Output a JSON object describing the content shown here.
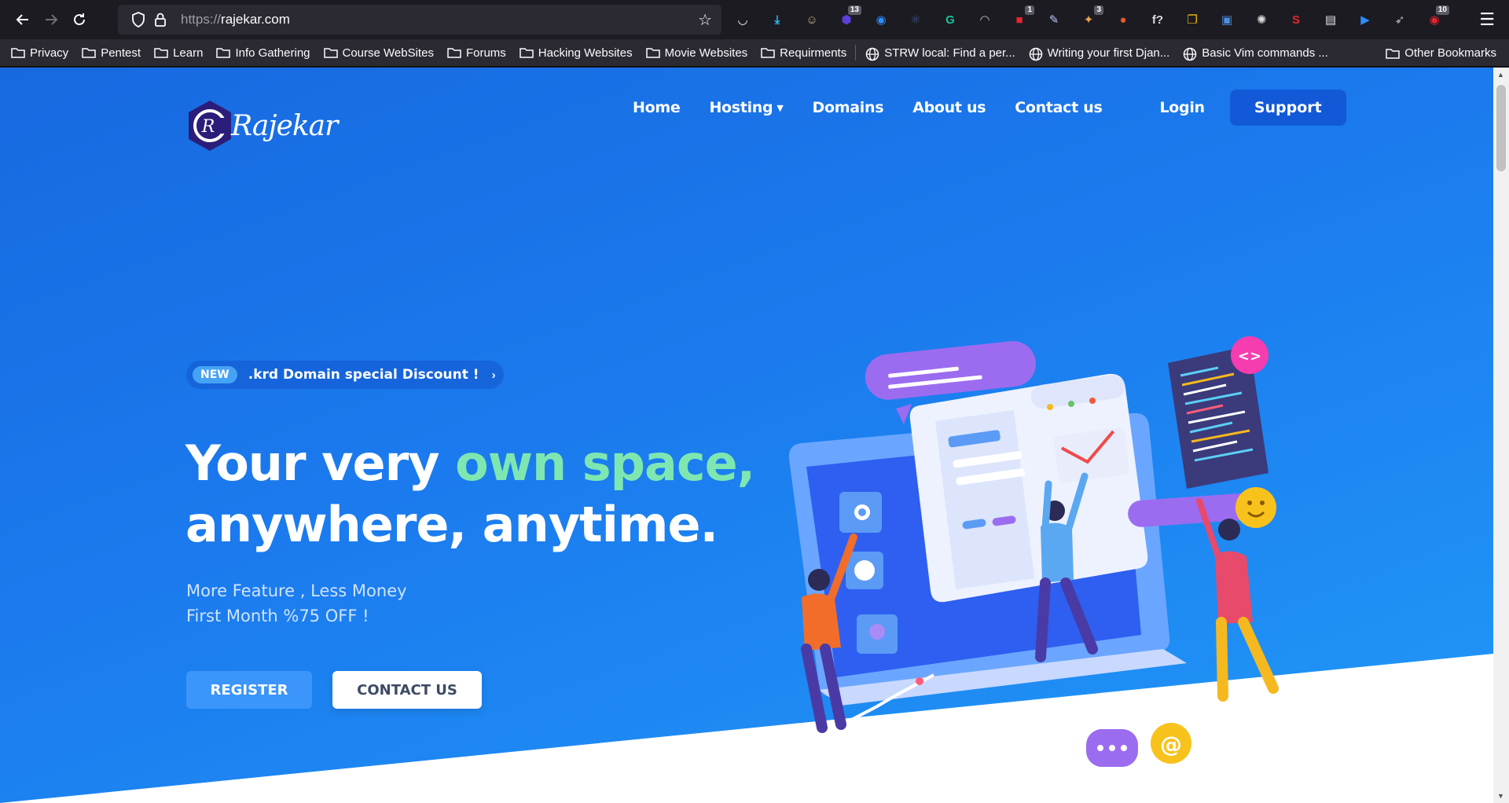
{
  "browser": {
    "url_scheme": "https://",
    "url_host": "rajekar.com",
    "extensions": [
      {
        "name": "pocket-icon",
        "color": "#fbfbfe",
        "glyph": "◡",
        "badge": ""
      },
      {
        "name": "download-icon",
        "color": "#2ac3ff",
        "glyph": "⤓",
        "badge": ""
      },
      {
        "name": "avatar-ext-icon",
        "color": "#c9b38b",
        "glyph": "☺",
        "badge": ""
      },
      {
        "name": "shield-ext-icon",
        "color": "#5b3fd6",
        "glyph": "⬢",
        "badge": "13"
      },
      {
        "name": "circle-ext-icon",
        "color": "#2b8cff",
        "glyph": "◉",
        "badge": ""
      },
      {
        "name": "react-ext-icon",
        "color": "#3d5a8c",
        "glyph": "⚛",
        "badge": ""
      },
      {
        "name": "grammarly-icon",
        "color": "#15c39a",
        "glyph": "G",
        "badge": ""
      },
      {
        "name": "arc-ext-icon",
        "color": "#bdbdbd",
        "glyph": "◠",
        "badge": ""
      },
      {
        "name": "red-ext-icon",
        "color": "#e3262f",
        "glyph": "■",
        "badge": "1"
      },
      {
        "name": "pen-ext-icon",
        "color": "#bfc4ff",
        "glyph": "✎",
        "badge": ""
      },
      {
        "name": "fox-ext-icon",
        "color": "#e8a34a",
        "glyph": "✦",
        "badge": "3"
      },
      {
        "name": "round-ext-icon",
        "color": "#e35a2a",
        "glyph": "●",
        "badge": ""
      },
      {
        "name": "function-ext-icon",
        "color": "#dcdcdc",
        "glyph": "f?",
        "badge": ""
      },
      {
        "name": "copy-ext-icon",
        "color": "#f2b90f",
        "glyph": "❐",
        "badge": ""
      },
      {
        "name": "lock-ext-icon",
        "color": "#4a90e2",
        "glyph": "▣",
        "badge": ""
      },
      {
        "name": "cookie-ext-icon",
        "color": "#dcdcdc",
        "glyph": "✺",
        "badge": ""
      },
      {
        "name": "s-ext-icon",
        "color": "#e3262f",
        "glyph": "S",
        "badge": ""
      },
      {
        "name": "wechat-ext-icon",
        "color": "#e6e6e6",
        "glyph": "▤",
        "badge": ""
      },
      {
        "name": "zoom-ext-icon",
        "color": "#2d8cff",
        "glyph": "▶",
        "badge": ""
      },
      {
        "name": "wing-ext-icon",
        "color": "#bdbdbd",
        "glyph": "➶",
        "badge": ""
      },
      {
        "name": "record-ext-icon",
        "color": "#e3262f",
        "glyph": "◉",
        "badge": "10"
      }
    ]
  },
  "bookmarks": [
    {
      "label": "Privacy",
      "type": "folder"
    },
    {
      "label": "Pentest",
      "type": "folder"
    },
    {
      "label": "Learn",
      "type": "folder"
    },
    {
      "label": "Info Gathering",
      "type": "folder"
    },
    {
      "label": "Course WebSites",
      "type": "folder"
    },
    {
      "label": "Forums",
      "type": "folder"
    },
    {
      "label": "Hacking Websites",
      "type": "folder"
    },
    {
      "label": "Movie Websites",
      "type": "folder"
    },
    {
      "label": "Requirments",
      "type": "folder"
    },
    {
      "label": "STRW local: Find a per...",
      "type": "site"
    },
    {
      "label": "Writing your first Djan...",
      "type": "site"
    },
    {
      "label": "Basic Vim commands ...",
      "type": "site"
    }
  ],
  "bookmarks_other": "Other Bookmarks",
  "site": {
    "logo_text": "Rajekar",
    "nav": {
      "home": "Home",
      "hosting": "Hosting",
      "domains": "Domains",
      "about": "About us",
      "contact": "Contact us",
      "login": "Login",
      "support": "Support"
    },
    "promo": {
      "badge": "NEW",
      "text": ".krd Domain special Discount !"
    },
    "headline": {
      "part1": "Your very ",
      "accent": "own space,",
      "line2": "anywhere, anytime."
    },
    "sub_line1": "More Feature , Less Money",
    "sub_line2": "First Month %75 OFF !",
    "cta_register": "REGISTER",
    "cta_contact": "CONTACT US"
  },
  "colors": {
    "hero_gradient_start": "#1869e0",
    "hero_gradient_end": "#2199f7",
    "accent_green": "#7ee7b1",
    "support_button": "#1259d8",
    "register_button": "#3b95fb"
  }
}
